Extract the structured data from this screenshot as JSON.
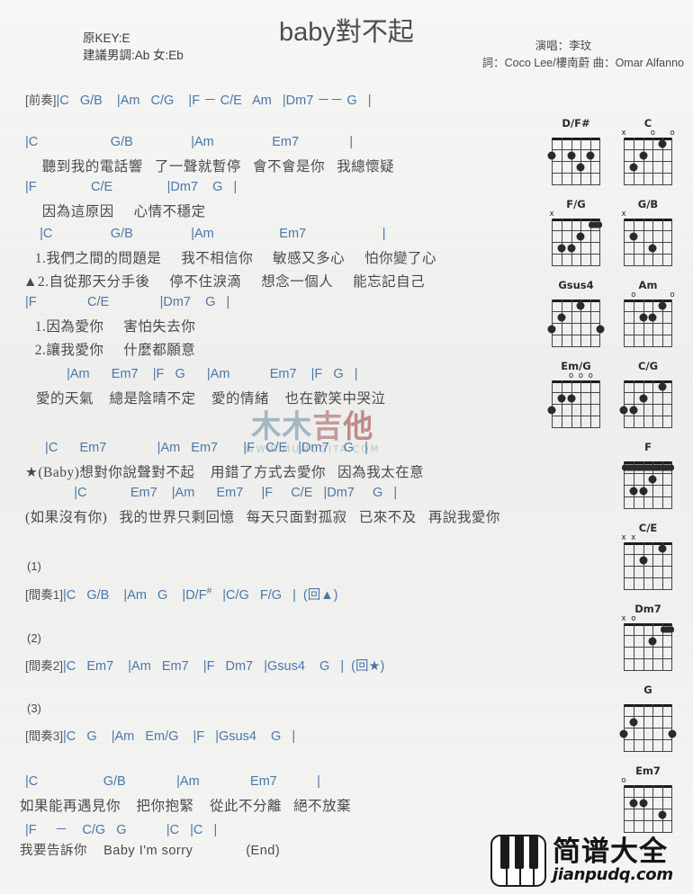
{
  "header": {
    "title": "baby對不起",
    "key_line1": "原KEY:E",
    "key_line2": "建議男調:Ab 女:Eb",
    "singer": "演唱：李玟",
    "writers": "詞：Coco Lee/樓南蔚  曲：Omar Alfanno"
  },
  "watermark": {
    "ch1": "木",
    "ch2": "木",
    "ch3": "吉",
    "ch4": "他",
    "url": "WWW.MUMUGITA.COM"
  },
  "logo": {
    "cn": "简谱大全",
    "en": "jianpudq.com"
  },
  "intro": {
    "label": "[前奏]",
    "chords": "|C   G/B    |Am   C/G    |F － C/E   Am   |Dm7 －－ G   |"
  },
  "sections": [
    {
      "name": "verse-1",
      "lines": [
        {
          "type": "chord",
          "text": "|C                    G/B                |Am                Em7              |"
        },
        {
          "type": "lyric",
          "text": "  聽到我的電話響   了一聲就暫停   會不會是你   我總懷疑"
        },
        {
          "type": "chord",
          "text": "|F               C/E               |Dm7    G   |"
        },
        {
          "type": "lyric",
          "text": "  因為這原因     心情不穩定"
        }
      ]
    },
    {
      "name": "verse-2",
      "lines": [
        {
          "type": "chord",
          "text": "    |C                G/B                |Am                  Em7                     |"
        },
        {
          "type": "lyric",
          "text": "  1.我們之間的問題是     我不相信你     敏感又多心     怕你變了心"
        },
        {
          "type": "lyric",
          "text": "▲2.自從那天分手後     停不住淚滴     想念一個人     能忘記自己"
        },
        {
          "type": "chord",
          "text": "|F              C/E              |Dm7    G   |"
        },
        {
          "type": "lyric",
          "text": "  1.因為愛你     害怕失去你"
        },
        {
          "type": "lyric",
          "text": "  2.讓我愛你     什麼都願意"
        }
      ]
    },
    {
      "name": "pre-chorus",
      "lines": [
        {
          "type": "chord",
          "text": "    |Am      Em7    |F   G      |Am           Em7    |F   G   |"
        },
        {
          "type": "lyric",
          "text": "愛的天氣    總是陰晴不定    愛的情緒    也在歡笑中哭泣"
        }
      ]
    },
    {
      "name": "chorus",
      "lines": [
        {
          "type": "chord",
          "text": "  |C      Em7              |Am   Em7       |F   C/E   |Dm7    G   |"
        },
        {
          "type": "lyric",
          "text": "★(Baby)想對你說聲對不起    用錯了方式去愛你   因為我太在意"
        },
        {
          "type": "chord",
          "text": "          |C            Em7    |Am      Em7     |F     C/E   |Dm7     G   |"
        },
        {
          "type": "lyric",
          "text": "(如果沒有你)   我的世界只剩回憶   每天只面對孤寂   已來不及   再說我愛你"
        }
      ]
    }
  ],
  "interludes": [
    {
      "num": "(1)",
      "label": "[間奏1]",
      "chords": "|C   G/B    |Am   G    |D/F",
      "sharp": "#",
      "chords_tail": "   |C/G   F/G   |  (回▲)"
    },
    {
      "num": "(2)",
      "label": "[間奏2]",
      "chords": "|C   Em7    |Am   Em7    |F   Dm7   |Gsus4    G   |  (回★)",
      "sharp": "",
      "chords_tail": ""
    },
    {
      "num": "(3)",
      "label": "[間奏3]",
      "chords": "|C   G    |Am   Em/G    |F   |Gsus4    G   |",
      "sharp": "",
      "chords_tail": ""
    }
  ],
  "ending": {
    "lines": [
      {
        "type": "chord",
        "text": "|C                  G/B              |Am              Em7           |"
      },
      {
        "type": "lyric",
        "text": "如果能再遇見你    把你抱緊    從此不分離   絕不放棄"
      },
      {
        "type": "chord",
        "text": "|F     －    C/G   G           |C   |C   |"
      },
      {
        "type": "lyric",
        "text": "我要告訴你    Baby I'm sorry             (End)"
      }
    ]
  },
  "diagrams": [
    {
      "name": "D/F#",
      "marks": [],
      "dots": [
        {
          "s": 6,
          "f": 2
        },
        {
          "s": 4,
          "f": 2
        },
        {
          "s": 2,
          "f": 2
        },
        {
          "s": 3,
          "f": 3
        }
      ],
      "barre": null,
      "col": 0,
      "row": 0
    },
    {
      "name": "C",
      "marks": [
        {
          "s": 6,
          "t": "x"
        },
        {
          "s": 3,
          "t": "o"
        },
        {
          "s": 1,
          "t": "o"
        }
      ],
      "dots": [
        {
          "s": 5,
          "f": 3
        },
        {
          "s": 4,
          "f": 2
        },
        {
          "s": 2,
          "f": 1
        }
      ],
      "barre": null,
      "col": 1,
      "row": 0
    },
    {
      "name": "F/G",
      "marks": [
        {
          "s": 6,
          "t": "x"
        }
      ],
      "dots": [
        {
          "s": 5,
          "f": 3
        },
        {
          "s": 4,
          "f": 3
        },
        {
          "s": 3,
          "f": 2
        }
      ],
      "barre": {
        "f": 1,
        "from": 2,
        "to": 1
      },
      "col": 0,
      "row": 1
    },
    {
      "name": "G/B",
      "marks": [
        {
          "s": 6,
          "t": "x"
        }
      ],
      "dots": [
        {
          "s": 5,
          "f": 2
        },
        {
          "s": 3,
          "f": 3
        }
      ],
      "barre": null,
      "col": 1,
      "row": 1
    },
    {
      "name": "Gsus4",
      "marks": [],
      "dots": [
        {
          "s": 6,
          "f": 3
        },
        {
          "s": 5,
          "f": 2
        },
        {
          "s": 3,
          "f": 1
        },
        {
          "s": 1,
          "f": 3
        }
      ],
      "barre": null,
      "col": 0,
      "row": 2
    },
    {
      "name": "Am",
      "marks": [
        {
          "s": 5,
          "t": "o"
        },
        {
          "s": 1,
          "t": "o"
        }
      ],
      "dots": [
        {
          "s": 4,
          "f": 2
        },
        {
          "s": 3,
          "f": 2
        },
        {
          "s": 2,
          "f": 1
        }
      ],
      "barre": null,
      "col": 1,
      "row": 2
    },
    {
      "name": "Em/G",
      "marks": [
        {
          "s": 4,
          "t": "o"
        },
        {
          "s": 3,
          "t": "o"
        },
        {
          "s": 2,
          "t": "o"
        }
      ],
      "dots": [
        {
          "s": 6,
          "f": 3
        },
        {
          "s": 5,
          "f": 2
        },
        {
          "s": 4,
          "f": 2
        }
      ],
      "barre": null,
      "col": 0,
      "row": 3
    },
    {
      "name": "C/G",
      "marks": [],
      "dots": [
        {
          "s": 6,
          "f": 3
        },
        {
          "s": 5,
          "f": 3
        },
        {
          "s": 4,
          "f": 2
        },
        {
          "s": 2,
          "f": 1
        }
      ],
      "barre": null,
      "col": 1,
      "row": 3
    },
    {
      "name": "F",
      "marks": [],
      "dots": [
        {
          "s": 5,
          "f": 3
        },
        {
          "s": 4,
          "f": 3
        },
        {
          "s": 3,
          "f": 2
        }
      ],
      "barre": {
        "f": 1,
        "from": 6,
        "to": 1
      },
      "col": 1,
      "row": 4
    },
    {
      "name": "C/E",
      "marks": [
        {
          "s": 6,
          "t": "x"
        },
        {
          "s": 5,
          "t": "x"
        }
      ],
      "dots": [
        {
          "s": 4,
          "f": 2
        },
        {
          "s": 2,
          "f": 1
        }
      ],
      "barre": null,
      "col": 1,
      "row": 5
    },
    {
      "name": "Dm7",
      "marks": [
        {
          "s": 6,
          "t": "x"
        },
        {
          "s": 5,
          "t": "o"
        }
      ],
      "dots": [
        {
          "s": 3,
          "f": 2
        }
      ],
      "barre": {
        "f": 1,
        "from": 2,
        "to": 1
      },
      "col": 1,
      "row": 6
    },
    {
      "name": "G",
      "marks": [],
      "dots": [
        {
          "s": 6,
          "f": 3
        },
        {
          "s": 5,
          "f": 2
        },
        {
          "s": 1,
          "f": 3
        }
      ],
      "barre": null,
      "col": 1,
      "row": 7
    },
    {
      "name": "Em7",
      "marks": [
        {
          "s": 6,
          "t": "o"
        }
      ],
      "dots": [
        {
          "s": 5,
          "f": 2
        },
        {
          "s": 4,
          "f": 2
        },
        {
          "s": 2,
          "f": 3
        }
      ],
      "barre": null,
      "col": 1,
      "row": 8
    }
  ]
}
